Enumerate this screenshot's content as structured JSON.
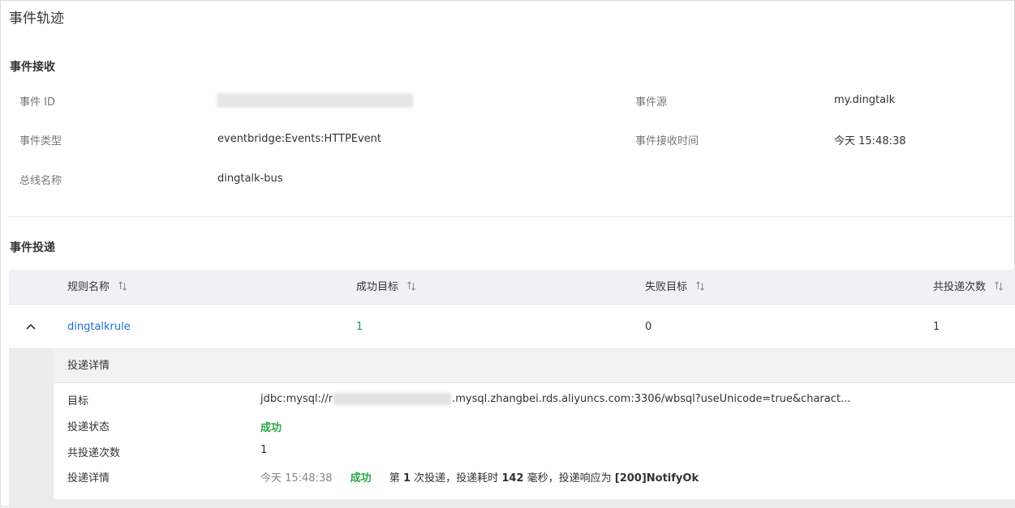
{
  "page": {
    "title": "事件轨迹"
  },
  "receive": {
    "section_title": "事件接收",
    "event_id_label": "事件 ID",
    "event_type_label": "事件类型",
    "event_type_value": "eventbridge:Events:HTTPEvent",
    "bus_label": "总线名称",
    "bus_value": "dingtalk-bus",
    "source_label": "事件源",
    "source_value": "my.dingtalk",
    "time_label": "事件接收时间",
    "time_value": "今天 15:48:38"
  },
  "delivery": {
    "section_title": "事件投递",
    "columns": [
      "规则名称",
      "成功目标",
      "失败目标",
      "共投递次数"
    ],
    "rows": [
      {
        "rule": "dingtalkrule",
        "success": "1",
        "failed": "0",
        "total": "1"
      }
    ],
    "detail": {
      "title": "投递详情",
      "target_label": "目标",
      "target_prefix": "jdbc:mysql://r",
      "target_suffix": ".mysql.zhangbei.rds.aliyuncs.com:3306/wbsql?useUnicode=true&charact...",
      "status_label": "投递状态",
      "status_value": "成功",
      "count_label": "共投递次数",
      "count_value": "1",
      "log_label": "投递详情",
      "log_time": "今天 15:48:38",
      "log_status": "成功",
      "log_text_1": "第",
      "log_attempt": "1",
      "log_text_2": "次投递，投递耗时",
      "log_duration": "142",
      "log_text_3": "毫秒，投递响应为",
      "log_response": "[200]NotifyOk"
    }
  },
  "icons": {
    "sort": "sort-icon",
    "collapse": "chevron-up-icon"
  },
  "colors": {
    "link": "#1f6fd1",
    "success": "#28a745",
    "teal": "#1a8f7a"
  }
}
